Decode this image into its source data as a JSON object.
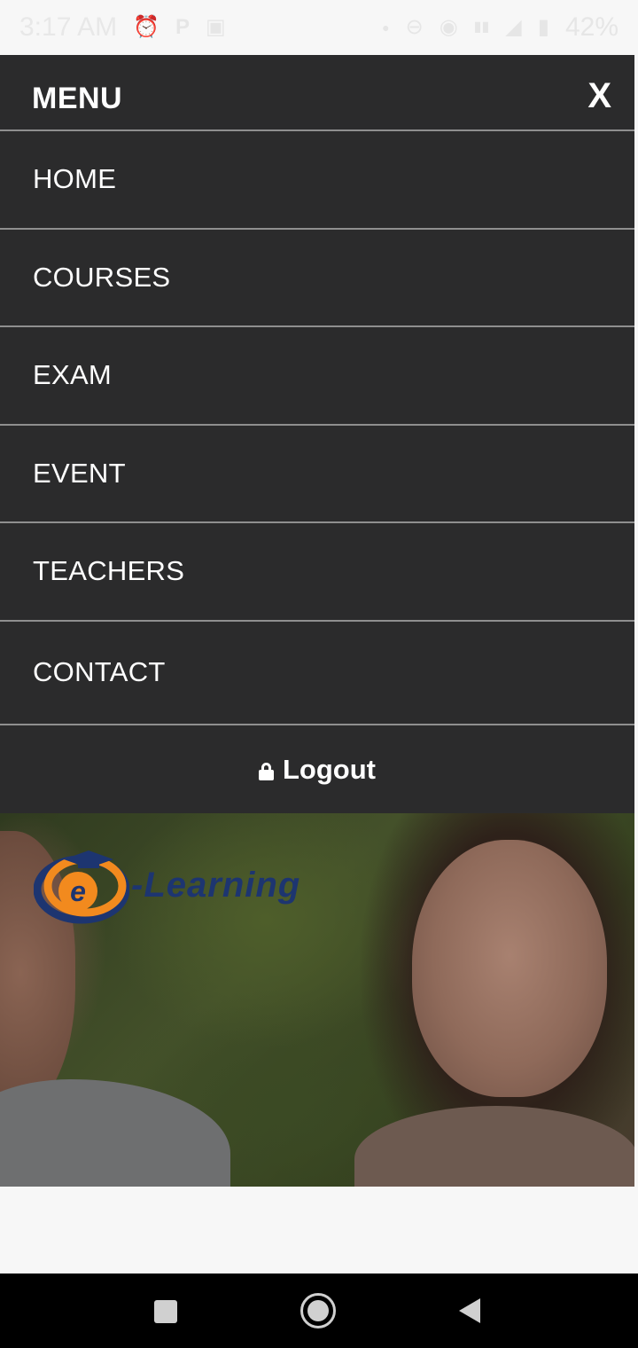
{
  "status_bar": {
    "time": "3:17 AM",
    "battery": "42%",
    "icons": [
      "alarm-icon",
      "parking-icon",
      "screenshot-icon",
      "dot-icon",
      "dnd-icon",
      "hotspot-icon",
      "signal-volte-icon",
      "wifi-calling-icon",
      "battery-icon"
    ]
  },
  "menu": {
    "title": "MENU",
    "close_label": "X",
    "items": [
      {
        "label": "HOME"
      },
      {
        "label": "COURSES"
      },
      {
        "label": "EXAM"
      },
      {
        "label": "EVENT"
      },
      {
        "label": "TEACHERS"
      },
      {
        "label": "CONTACT"
      }
    ],
    "logout_label": "Logout"
  },
  "hero": {
    "logo_text": "-Learning",
    "logo_letter": "e"
  },
  "colors": {
    "menu_bg": "#2b2b2c",
    "divider": "#8f8f8f",
    "logo_blue": "#1d3570",
    "logo_orange": "#f28a1e"
  }
}
